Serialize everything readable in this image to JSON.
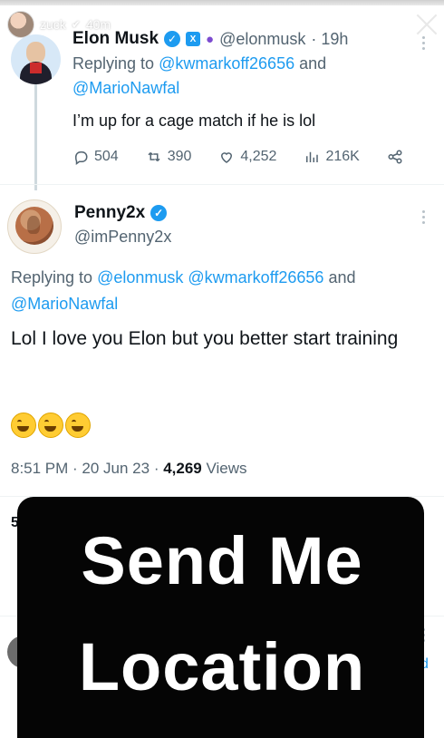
{
  "story": {
    "username": "zuck",
    "age": "40m"
  },
  "tweet1": {
    "name": "Elon Musk",
    "handle": "@elonmusk",
    "time": "· 19h",
    "replying_prefix": "Replying to",
    "mention1": "@kwmarkoff26656",
    "and": "and",
    "mention2": "@MarioNawfal",
    "text": "I’m up for a cage match if he is lol",
    "replies": "504",
    "retweets": "390",
    "likes": "4,252",
    "views": "216K"
  },
  "tweet2": {
    "name": "Penny2x",
    "handle": "@imPenny2x",
    "replying_prefix": "Replying to",
    "mention1": "@elonmusk",
    "mention2": "@kwmarkoff26656",
    "and": "and",
    "mention3": "@MarioNawfal",
    "text": "Lol I love you Elon but you better start training",
    "time": "8:51 PM · 20 Jun 23 ·",
    "views_count": "4,269",
    "views_label": "Views"
  },
  "background_fragment": {
    "partial_text": "5",
    "partial_link": "d"
  },
  "sticker": {
    "line1": "Send Me",
    "line2": "Location"
  },
  "colors": {
    "accent": "#1d9bf0",
    "text_primary": "#0f1419",
    "text_secondary": "#536471",
    "sticker_bg": "#050505"
  }
}
